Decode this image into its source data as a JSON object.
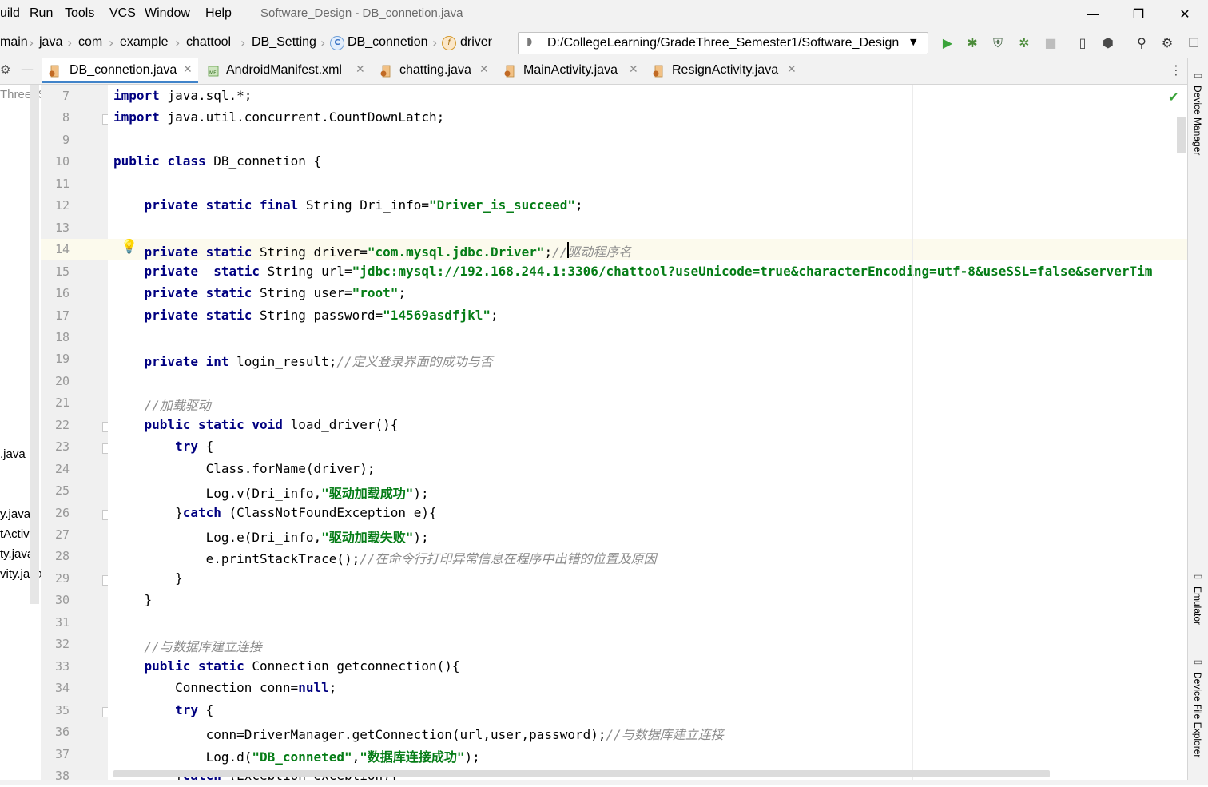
{
  "menu": {
    "items": [
      "uild",
      "Run",
      "Tools",
      "VCS",
      "Window",
      "Help"
    ],
    "title": "Software_Design - DB_connetion.java"
  },
  "window_controls": {
    "minimize": "—",
    "maximize": "❐",
    "close": "✕"
  },
  "breadcrumb": [
    "main",
    "java",
    "com",
    "example",
    "chattool",
    "DB_Setting",
    "DB_connetion",
    "driver"
  ],
  "run_config": {
    "path": "D:/CollegeLearning/GradeThree_Semester1/Software_Design"
  },
  "tabs": [
    {
      "label": "DB_connetion.java",
      "active": true,
      "icon": "java-class-icon"
    },
    {
      "label": "AndroidManifest.xml",
      "active": false,
      "icon": "manifest-icon"
    },
    {
      "label": "chatting.java",
      "active": false,
      "icon": "java-class-icon"
    },
    {
      "label": "MainActivity.java",
      "active": false,
      "icon": "java-class-icon"
    },
    {
      "label": "ResignActivity.java",
      "active": false,
      "icon": "java-class-icon"
    }
  ],
  "left_panel": {
    "items": [
      "Three_S",
      ".java",
      "y.java",
      "tActivit",
      "ty.java",
      "vity.java"
    ]
  },
  "right_strip": {
    "items": [
      "Device Manager",
      "Emulator",
      "Device File Explorer"
    ]
  },
  "editor": {
    "highlight_line": 14,
    "lines": [
      {
        "n": "7",
        "text": "import java.sql.*;"
      },
      {
        "n": "8",
        "text": "import java.util.concurrent.CountDownLatch;"
      },
      {
        "n": "9",
        "text": ""
      },
      {
        "n": "10",
        "text": "public class DB_connetion {"
      },
      {
        "n": "11",
        "text": ""
      },
      {
        "n": "12",
        "text": "    private static final String Dri_info=\"Driver_is_succeed\";"
      },
      {
        "n": "13",
        "text": ""
      },
      {
        "n": "14",
        "text": "    private static String driver=\"com.mysql.jdbc.Driver\";//驱动程序名"
      },
      {
        "n": "15",
        "text": "    private  static String url=\"jdbc:mysql://192.168.244.1:3306/chattool?useUnicode=true&characterEncoding=utf-8&useSSL=false&serverTim"
      },
      {
        "n": "16",
        "text": "    private static String user=\"root\";"
      },
      {
        "n": "17",
        "text": "    private static String password=\"14569asdfjkl\";"
      },
      {
        "n": "18",
        "text": ""
      },
      {
        "n": "19",
        "text": "    private int login_result;//定义登录界面的成功与否"
      },
      {
        "n": "20",
        "text": ""
      },
      {
        "n": "21",
        "text": "    //加载驱动"
      },
      {
        "n": "22",
        "text": "    public static void load_driver(){"
      },
      {
        "n": "23",
        "text": "        try {"
      },
      {
        "n": "24",
        "text": "            Class.forName(driver);"
      },
      {
        "n": "25",
        "text": "            Log.v(Dri_info,\"驱动加载成功\");"
      },
      {
        "n": "26",
        "text": "        }catch (ClassNotFoundException e){"
      },
      {
        "n": "27",
        "text": "            Log.e(Dri_info,\"驱动加载失败\");"
      },
      {
        "n": "28",
        "text": "            e.printStackTrace();//在命令行打印异常信息在程序中出错的位置及原因"
      },
      {
        "n": "29",
        "text": "        }"
      },
      {
        "n": "30",
        "text": "    }"
      },
      {
        "n": "31",
        "text": ""
      },
      {
        "n": "32",
        "text": "    //与数据库建立连接"
      },
      {
        "n": "33",
        "text": "    public static Connection getconnection(){"
      },
      {
        "n": "34",
        "text": "        Connection conn=null;"
      },
      {
        "n": "35",
        "text": "        try {"
      },
      {
        "n": "36",
        "text": "            conn=DriverManager.getConnection(url,user,password);//与数据库建立连接"
      },
      {
        "n": "37",
        "text": "            Log.d(\"DB_conneted\",\"数据库连接成功\");"
      },
      {
        "n": "38",
        "text": "        }catch (Exception exception){"
      }
    ]
  }
}
